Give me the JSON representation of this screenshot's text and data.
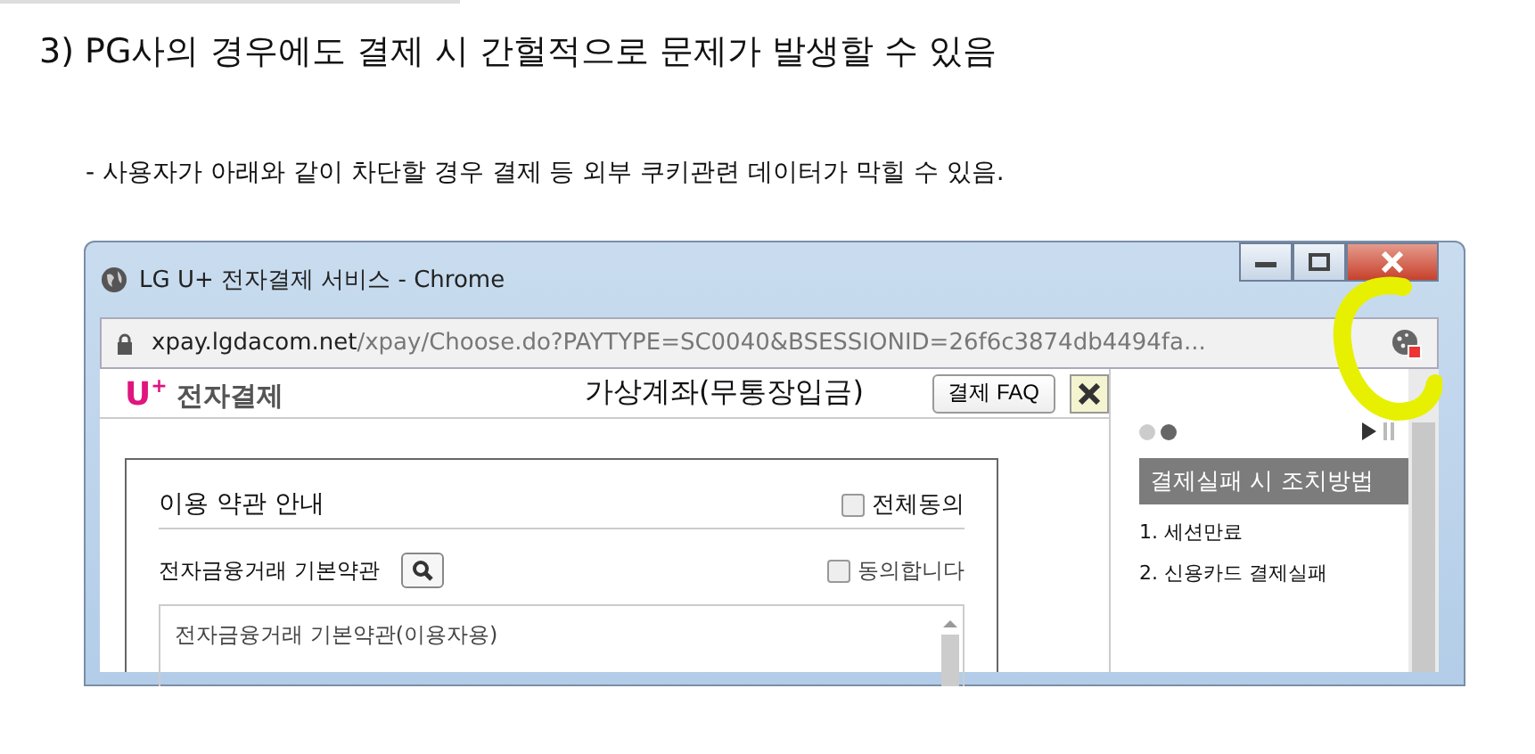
{
  "heading": "3) PG사의 경우에도 결제 시 간헐적으로 문제가 발생할 수 있음",
  "note": "- 사용자가 아래와 같이 차단할 경우 결제 등 외부 쿠키관련 데이터가 막힐 수 있음.",
  "screenshot": {
    "window": {
      "title": "LG U+ 전자결제 서비스 - Chrome",
      "url_host": "xpay.lgdacom.net",
      "url_path": "/xpay/Choose.do?PAYTYPE=SC0040&BSESSIONID=26f6c3874db4494fa...",
      "cookie_blocked": true
    },
    "page": {
      "logo_mark": "U",
      "logo_sup": "+",
      "logo_text": "전자결제",
      "title": "가상계좌(무통장입금)",
      "faq_button": "결제 FAQ"
    },
    "terms": {
      "title": "이용 약관 안내",
      "agree_all": {
        "label": "전체동의",
        "checked": false
      },
      "items": [
        {
          "label": "전자금융거래 기본약관",
          "agree_label": "동의합니다",
          "checked": false,
          "content": "전자금융거래 기본약관(이용자용)"
        }
      ]
    },
    "side": {
      "slides": [
        {
          "selected": false
        },
        {
          "selected": true
        }
      ],
      "heading": "결제실패 시 조치방법",
      "steps": [
        "1. 세션만료",
        "2. 신용카드 결제실패"
      ]
    }
  }
}
